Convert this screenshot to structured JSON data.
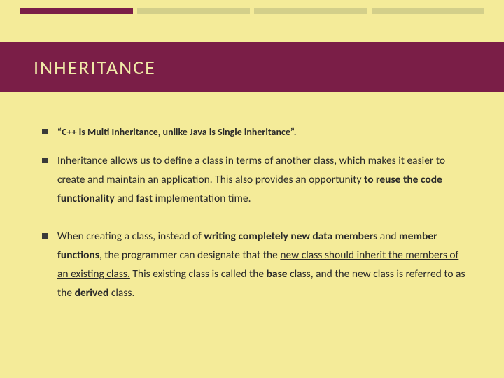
{
  "title": "INHERITANCE",
  "bullets": {
    "b1": "“C++ is Multi Inheritance, unlike Java is Single inheritance”.",
    "b2": {
      "t1": "Inheritance allows us to define a class in terms of another class, which makes it easier to create and maintain an application. This also provides an opportunity ",
      "t2": "to reuse the code functionality",
      "t3": " and ",
      "t4": "fast",
      "t5": " implementation time."
    },
    "b3": {
      "t1": "When creating a class, instead of ",
      "t2": "writing completely new data members",
      "t3": " and ",
      "t4": "member functions",
      "t5": ", the programmer can designate that the ",
      "t6": "new class should inherit the members of an existing class.",
      "t7": " This existing class is called the ",
      "t8": "base",
      "t9": " class, and the new class is referred to as the ",
      "t10": "derived",
      "t11": " class."
    }
  }
}
